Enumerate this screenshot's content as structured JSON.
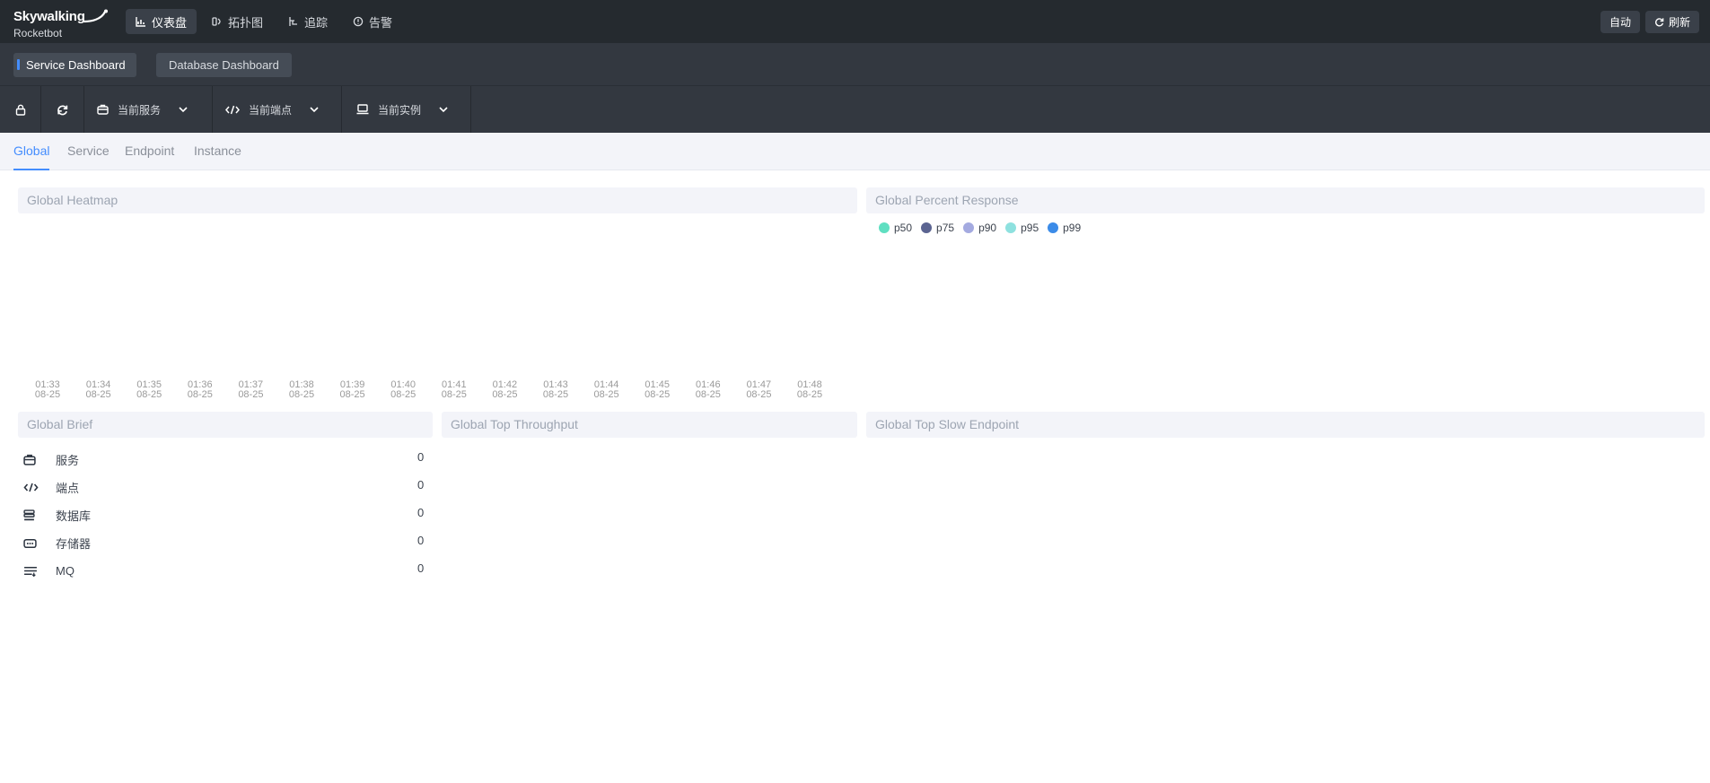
{
  "header": {
    "logo_top": "Skywalking",
    "logo_bottom": "Rocketbot",
    "nav": [
      {
        "label": "仪表盘",
        "icon": "chart-icon",
        "active": true
      },
      {
        "label": "拓扑图",
        "icon": "topology-icon",
        "active": false
      },
      {
        "label": "追踪",
        "icon": "trace-icon",
        "active": false
      },
      {
        "label": "告警",
        "icon": "alarm-icon",
        "active": false
      }
    ],
    "auto_label": "自动",
    "refresh_label": "刷新"
  },
  "dashboards": {
    "active": "Service Dashboard",
    "inactive": "Database Dashboard"
  },
  "selectors": {
    "service": "当前服务",
    "endpoint": "当前端点",
    "instance": "当前实例"
  },
  "view_tabs": [
    "Global",
    "Service",
    "Endpoint",
    "Instance"
  ],
  "active_view_tab": "Global",
  "panels": {
    "heatmap_title": "Global Heatmap",
    "percent_title": "Global Percent Response",
    "brief_title": "Global Brief",
    "throughput_title": "Global Top Throughput",
    "slow_title": "Global Top Slow Endpoint"
  },
  "legend": [
    {
      "name": "p50",
      "color": "#5fdfc1"
    },
    {
      "name": "p75",
      "color": "#5b6491"
    },
    {
      "name": "p90",
      "color": "#a4aae0"
    },
    {
      "name": "p95",
      "color": "#8ee1df"
    },
    {
      "name": "p99",
      "color": "#3b8be8"
    }
  ],
  "heatmap_axis": {
    "times": [
      "01:33",
      "01:34",
      "01:35",
      "01:36",
      "01:37",
      "01:38",
      "01:39",
      "01:40",
      "01:41",
      "01:42",
      "01:43",
      "01:44",
      "01:45",
      "01:46",
      "01:47",
      "01:48"
    ],
    "date": "08-25"
  },
  "brief": [
    {
      "label": "服务",
      "value": "0",
      "icon": "service-icon"
    },
    {
      "label": "端点",
      "value": "0",
      "icon": "endpoint-icon"
    },
    {
      "label": "数据库",
      "value": "0",
      "icon": "database-icon"
    },
    {
      "label": "存储器",
      "value": "0",
      "icon": "cache-icon"
    },
    {
      "label": "MQ",
      "value": "0",
      "icon": "mq-icon"
    }
  ]
}
